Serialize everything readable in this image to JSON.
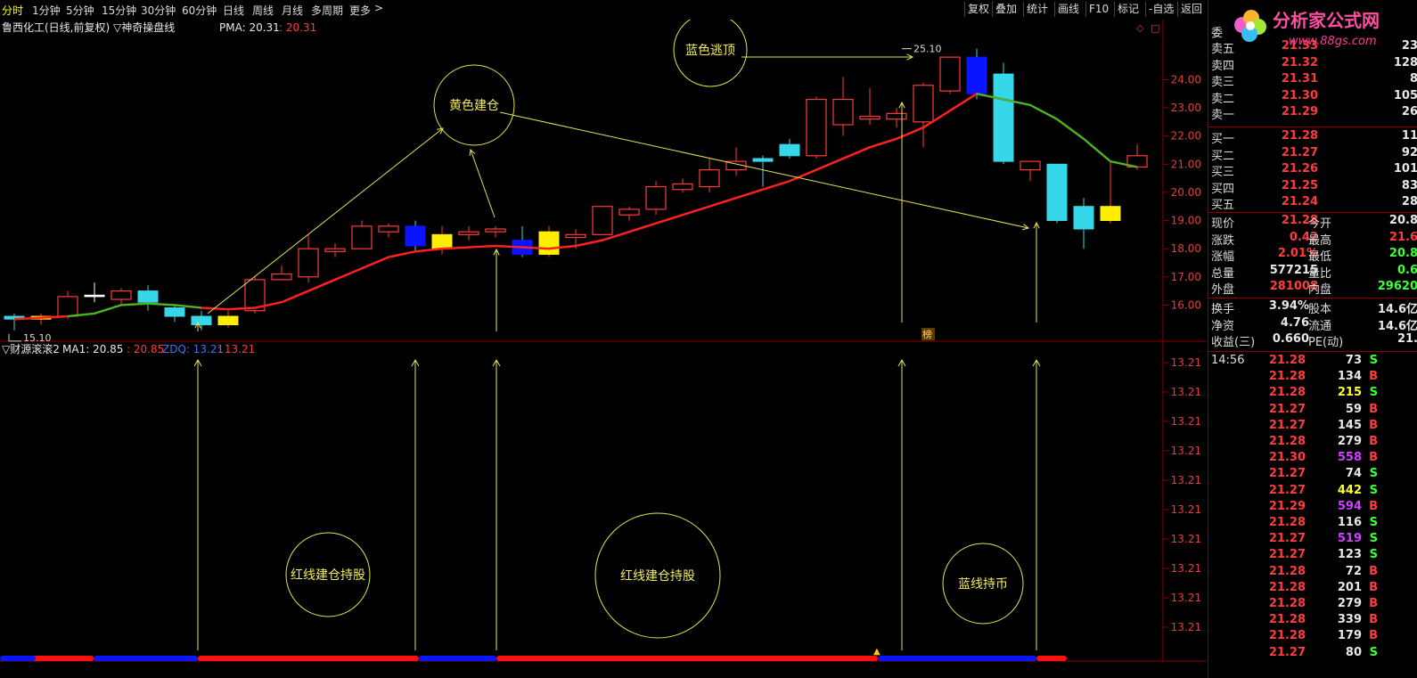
{
  "toolbar": {
    "tabs": [
      "分时",
      "1分钟",
      "5分钟",
      "15分钟",
      "30分钟",
      "60分钟",
      "日线",
      "周线",
      "月线",
      "多周期",
      "更多"
    ],
    "right_buttons": [
      "复权",
      "叠加",
      "统计",
      "画线",
      "F10",
      "标记",
      "-自选",
      "返回"
    ]
  },
  "main_chart": {
    "title": "鲁西化工(日线,前复权) ▽神奇操盘线",
    "pma_label": "PMA: 20.31",
    "pma_value": ": 20.31",
    "high_label": "25.10",
    "low_label": "15.10",
    "y_ticks": [
      "24.00",
      "23.00",
      "22.00",
      "21.00",
      "20.00",
      "19.00",
      "18.00",
      "17.00",
      "16.00"
    ],
    "annotations": {
      "yellow_circle": "黄色建仓",
      "blue_circle": "蓝色逃顶"
    },
    "badge": "榜"
  },
  "indicator_chart": {
    "title": "▽财源滚滚2",
    "ma1_label": "MA1: 20.85",
    "ma1_value": ": 20.85",
    "zdq_label": "ZDQ: 13.21",
    "zdq_value": ": 13.21",
    "y_ticks": [
      "13.21",
      "13.21",
      "13.21",
      "13.21",
      "13.21",
      "13.21",
      "13.21",
      "13.21",
      "13.21",
      "13.21"
    ],
    "annotations": {
      "left_circle": "红线建仓持股",
      "mid_circle": "红线建仓持股",
      "right_circle": "蓝线持币"
    }
  },
  "colors": {
    "up": "#ff3b3b",
    "down": "#36d7e8",
    "ma_red": "#ff2020",
    "ma_green": "#22cc22",
    "yellow": "#ffff00",
    "blue": "#0a14ff"
  },
  "order_book": {
    "header": "委",
    "asks": [
      {
        "label": "卖五",
        "price": "21.33",
        "vol": "23"
      },
      {
        "label": "卖四",
        "price": "21.32",
        "vol": "128"
      },
      {
        "label": "卖三",
        "price": "21.31",
        "vol": "8"
      },
      {
        "label": "卖二",
        "price": "21.30",
        "vol": "105"
      },
      {
        "label": "卖一",
        "price": "21.29",
        "vol": "26"
      }
    ],
    "bids": [
      {
        "label": "买一",
        "price": "21.28",
        "vol": "11"
      },
      {
        "label": "买二",
        "price": "21.27",
        "vol": "92"
      },
      {
        "label": "买三",
        "price": "21.26",
        "vol": "101"
      },
      {
        "label": "买四",
        "price": "21.25",
        "vol": "83"
      },
      {
        "label": "买五",
        "price": "21.24",
        "vol": "28"
      }
    ]
  },
  "quote": [
    {
      "l1": "现价",
      "v1": "21.28",
      "c1": "red",
      "l2": "今开",
      "v2": "20.8",
      "c2": "white"
    },
    {
      "l1": "涨跌",
      "v1": "0.42",
      "c1": "red",
      "l2": "最高",
      "v2": "21.6",
      "c2": "red"
    },
    {
      "l1": "涨幅",
      "v1": "2.01%",
      "c1": "red",
      "l2": "最低",
      "v2": "20.8",
      "c2": "green"
    },
    {
      "l1": "总量",
      "v1": "577215",
      "c1": "white",
      "l2": "量比",
      "v2": "0.6",
      "c2": "green"
    },
    {
      "l1": "外盘",
      "v1": "281008",
      "c1": "red",
      "l2": "内盘",
      "v2": "29620",
      "c2": "green"
    }
  ],
  "fundamentals": [
    {
      "l1": "换手",
      "v1": "3.94%",
      "l2": "股本",
      "v2": "14.6亿"
    },
    {
      "l1": "净资",
      "v1": "4.76",
      "l2": "流通",
      "v2": "14.6亿"
    },
    {
      "l1": "收益(三)",
      "v1": "0.660",
      "l2": "PE(动)",
      "v2": "21."
    }
  ],
  "ticks": [
    {
      "time": "14:56",
      "price": "21.28",
      "vol": "73",
      "side": "S",
      "pc": "red",
      "vc": "white"
    },
    {
      "time": "",
      "price": "21.28",
      "vol": "134",
      "side": "B",
      "pc": "red",
      "vc": "white"
    },
    {
      "time": "",
      "price": "21.28",
      "vol": "215",
      "side": "S",
      "pc": "red",
      "vc": "yellow"
    },
    {
      "time": "",
      "price": "21.27",
      "vol": "59",
      "side": "B",
      "pc": "red",
      "vc": "white"
    },
    {
      "time": "",
      "price": "21.27",
      "vol": "145",
      "side": "B",
      "pc": "red",
      "vc": "white"
    },
    {
      "time": "",
      "price": "21.28",
      "vol": "279",
      "side": "B",
      "pc": "red",
      "vc": "white"
    },
    {
      "time": "",
      "price": "21.30",
      "vol": "558",
      "side": "B",
      "pc": "red",
      "vc": "magenta"
    },
    {
      "time": "",
      "price": "21.27",
      "vol": "74",
      "side": "S",
      "pc": "red",
      "vc": "white"
    },
    {
      "time": "",
      "price": "21.27",
      "vol": "442",
      "side": "S",
      "pc": "red",
      "vc": "yellow"
    },
    {
      "time": "",
      "price": "21.29",
      "vol": "594",
      "side": "B",
      "pc": "red",
      "vc": "magenta"
    },
    {
      "time": "",
      "price": "21.28",
      "vol": "116",
      "side": "S",
      "pc": "red",
      "vc": "white"
    },
    {
      "time": "",
      "price": "21.27",
      "vol": "519",
      "side": "S",
      "pc": "red",
      "vc": "magenta"
    },
    {
      "time": "",
      "price": "21.27",
      "vol": "123",
      "side": "S",
      "pc": "red",
      "vc": "white"
    },
    {
      "time": "",
      "price": "21.28",
      "vol": "72",
      "side": "B",
      "pc": "red",
      "vc": "white"
    },
    {
      "time": "",
      "price": "21.28",
      "vol": "201",
      "side": "B",
      "pc": "red",
      "vc": "white"
    },
    {
      "time": "",
      "price": "21.28",
      "vol": "279",
      "side": "B",
      "pc": "red",
      "vc": "white"
    },
    {
      "time": "",
      "price": "21.28",
      "vol": "339",
      "side": "B",
      "pc": "red",
      "vc": "white"
    },
    {
      "time": "",
      "price": "21.28",
      "vol": "179",
      "side": "B",
      "pc": "red",
      "vc": "white"
    },
    {
      "time": "",
      "price": "21.27",
      "vol": "80",
      "side": "S",
      "pc": "red",
      "vc": "white"
    }
  ],
  "logo": {
    "title": "分析家公式网",
    "url": "www.88gs.com"
  },
  "chart_data": {
    "type": "candlestick",
    "candles": [
      {
        "o": 15.5,
        "c": 15.6,
        "h": 15.7,
        "l": 15.1,
        "color": "down"
      },
      {
        "o": 15.6,
        "c": 15.5,
        "h": 15.7,
        "l": 15.3,
        "color": "yellow"
      },
      {
        "o": 15.6,
        "c": 16.3,
        "h": 16.5,
        "l": 15.5,
        "color": "up"
      },
      {
        "o": 16.3,
        "c": 16.35,
        "h": 16.8,
        "l": 16.1,
        "color": "flat"
      },
      {
        "o": 16.2,
        "c": 16.5,
        "h": 16.6,
        "l": 16.0,
        "color": "up"
      },
      {
        "o": 16.5,
        "c": 16.1,
        "h": 16.7,
        "l": 15.8,
        "color": "down"
      },
      {
        "o": 15.9,
        "c": 15.6,
        "h": 16.0,
        "l": 15.4,
        "color": "down"
      },
      {
        "o": 15.6,
        "c": 15.3,
        "h": 15.8,
        "l": 15.1,
        "color": "down"
      },
      {
        "o": 15.3,
        "c": 15.6,
        "h": 15.8,
        "l": 15.2,
        "color": "yellow"
      },
      {
        "o": 15.8,
        "c": 16.9,
        "h": 17.0,
        "l": 15.7,
        "color": "up"
      },
      {
        "o": 16.9,
        "c": 17.1,
        "h": 17.4,
        "l": 16.9,
        "color": "up"
      },
      {
        "o": 17.0,
        "c": 18.0,
        "h": 18.5,
        "l": 16.8,
        "color": "up"
      },
      {
        "o": 17.9,
        "c": 18.0,
        "h": 18.2,
        "l": 17.7,
        "color": "up"
      },
      {
        "o": 18.0,
        "c": 18.8,
        "h": 19.0,
        "l": 18.0,
        "color": "up"
      },
      {
        "o": 18.6,
        "c": 18.8,
        "h": 18.9,
        "l": 18.4,
        "color": "up"
      },
      {
        "o": 18.8,
        "c": 18.1,
        "h": 19.0,
        "l": 17.9,
        "color": "blue_down"
      },
      {
        "o": 18.0,
        "c": 18.5,
        "h": 18.8,
        "l": 17.8,
        "color": "yellow"
      },
      {
        "o": 18.6,
        "c": 18.5,
        "h": 18.8,
        "l": 18.3,
        "color": "up"
      },
      {
        "o": 18.6,
        "c": 18.7,
        "h": 18.8,
        "l": 18.4,
        "color": "up"
      },
      {
        "o": 18.3,
        "c": 17.8,
        "h": 18.8,
        "l": 17.7,
        "color": "blue_down"
      },
      {
        "o": 17.8,
        "c": 18.6,
        "h": 18.8,
        "l": 17.7,
        "color": "yellow"
      },
      {
        "o": 18.4,
        "c": 18.5,
        "h": 18.7,
        "l": 18.0,
        "color": "up"
      },
      {
        "o": 18.5,
        "c": 19.5,
        "h": 19.5,
        "l": 18.5,
        "color": "up"
      },
      {
        "o": 19.4,
        "c": 19.2,
        "h": 19.5,
        "l": 19.0,
        "color": "up"
      },
      {
        "o": 19.4,
        "c": 20.2,
        "h": 20.4,
        "l": 19.2,
        "color": "up"
      },
      {
        "o": 20.1,
        "c": 20.3,
        "h": 20.5,
        "l": 20.0,
        "color": "up"
      },
      {
        "o": 20.2,
        "c": 20.8,
        "h": 21.2,
        "l": 20.0,
        "color": "up"
      },
      {
        "o": 20.8,
        "c": 21.1,
        "h": 21.6,
        "l": 20.6,
        "color": "up"
      },
      {
        "o": 21.2,
        "c": 21.1,
        "h": 21.3,
        "l": 20.2,
        "color": "down"
      },
      {
        "o": 21.3,
        "c": 21.7,
        "h": 21.9,
        "l": 21.2,
        "color": "down"
      },
      {
        "o": 21.3,
        "c": 23.3,
        "h": 23.4,
        "l": 21.2,
        "color": "up"
      },
      {
        "o": 22.4,
        "c": 23.3,
        "h": 24.1,
        "l": 22.0,
        "color": "up"
      },
      {
        "o": 22.6,
        "c": 22.7,
        "h": 23.7,
        "l": 22.4,
        "color": "up"
      },
      {
        "o": 22.6,
        "c": 22.8,
        "h": 23.0,
        "l": 22.3,
        "color": "up"
      },
      {
        "o": 22.5,
        "c": 23.8,
        "h": 23.9,
        "l": 21.6,
        "color": "up"
      },
      {
        "o": 23.6,
        "c": 24.8,
        "h": 24.8,
        "l": 23.5,
        "color": "up"
      },
      {
        "o": 24.8,
        "c": 23.5,
        "h": 25.1,
        "l": 23.3,
        "color": "blue_down"
      },
      {
        "o": 24.2,
        "c": 21.1,
        "h": 24.6,
        "l": 21.0,
        "color": "down"
      },
      {
        "o": 21.1,
        "c": 20.8,
        "h": 21.1,
        "l": 20.4,
        "color": "up"
      },
      {
        "o": 21.0,
        "c": 19.0,
        "h": 21.0,
        "l": 18.9,
        "color": "down"
      },
      {
        "o": 19.5,
        "c": 18.7,
        "h": 19.8,
        "l": 18.0,
        "color": "down"
      },
      {
        "o": 19.0,
        "c": 19.5,
        "h": 21.1,
        "l": 18.9,
        "color": "yellow"
      },
      {
        "o": 20.9,
        "c": 21.3,
        "h": 21.7,
        "l": 20.8,
        "color": "up"
      }
    ],
    "ma_line": [
      15.5,
      15.55,
      15.6,
      15.7,
      16.0,
      16.05,
      16.0,
      15.9,
      15.85,
      15.9,
      16.1,
      16.5,
      16.9,
      17.3,
      17.7,
      17.9,
      18.0,
      18.05,
      18.1,
      18.05,
      18.0,
      18.1,
      18.3,
      18.6,
      18.9,
      19.2,
      19.5,
      19.8,
      20.1,
      20.4,
      20.8,
      21.2,
      21.6,
      21.9,
      22.3,
      22.9,
      23.5,
      23.3,
      23.1,
      22.6,
      21.9,
      21.1,
      20.9
    ],
    "ylim": [
      15.0,
      25.5
    ],
    "bottom_band": [
      "blue",
      "red",
      "red",
      "red",
      "red",
      "red",
      "blue",
      "blue",
      "blue",
      "red",
      "red",
      "red",
      "red",
      "red",
      "red",
      "red",
      "blue",
      "blue",
      "blue",
      "red"
    ]
  }
}
